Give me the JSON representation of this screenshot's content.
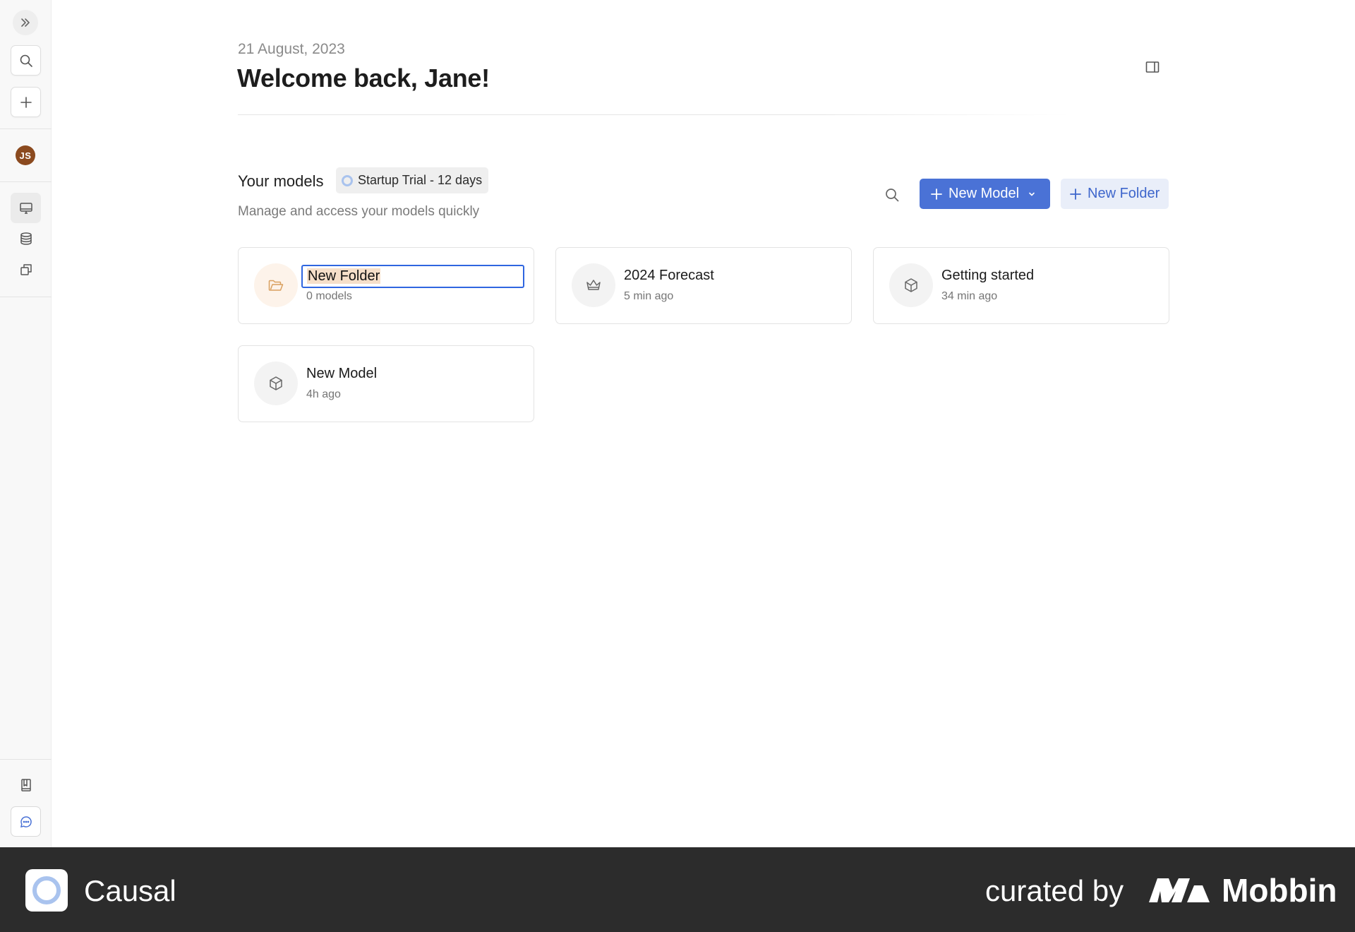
{
  "sidebar": {
    "expand_icon": "double-chevron-right-icon",
    "search_icon": "search-icon",
    "new_icon": "plus-icon",
    "avatar_initials": "JS",
    "nav_items": [
      "monitor-icon",
      "database-icon",
      "copy-icon"
    ],
    "bottom_items": [
      "book-icon",
      "chat-icon"
    ]
  },
  "header": {
    "date": "21 August, 2023",
    "welcome": "Welcome back, Jane!"
  },
  "models_section": {
    "title": "Your models",
    "trial_badge": "Startup Trial - 12 days",
    "subtitle": "Manage and access your models quickly",
    "new_model_label": "New Model",
    "new_folder_label": "New Folder"
  },
  "cards": [
    {
      "name": "New Folder",
      "meta": "0 models",
      "icon": "folder-icon",
      "editing": true
    },
    {
      "name": "2024 Forecast",
      "meta": "5 min ago",
      "icon": "crown-icon"
    },
    {
      "name": "Getting started",
      "meta": "34 min ago",
      "icon": "cube-icon"
    },
    {
      "name": "New Model",
      "meta": "4h ago",
      "icon": "cube-icon"
    }
  ],
  "footer": {
    "brand": "Causal",
    "curated_by": "curated by",
    "mobbin": "Mobbin"
  },
  "colors": {
    "primary": "#4a72d6",
    "secondary_bg": "#e9eef9",
    "avatar": "#8b4a1f",
    "trial_ring": "#a9c3ee",
    "footer_bg": "#2c2c2c"
  }
}
